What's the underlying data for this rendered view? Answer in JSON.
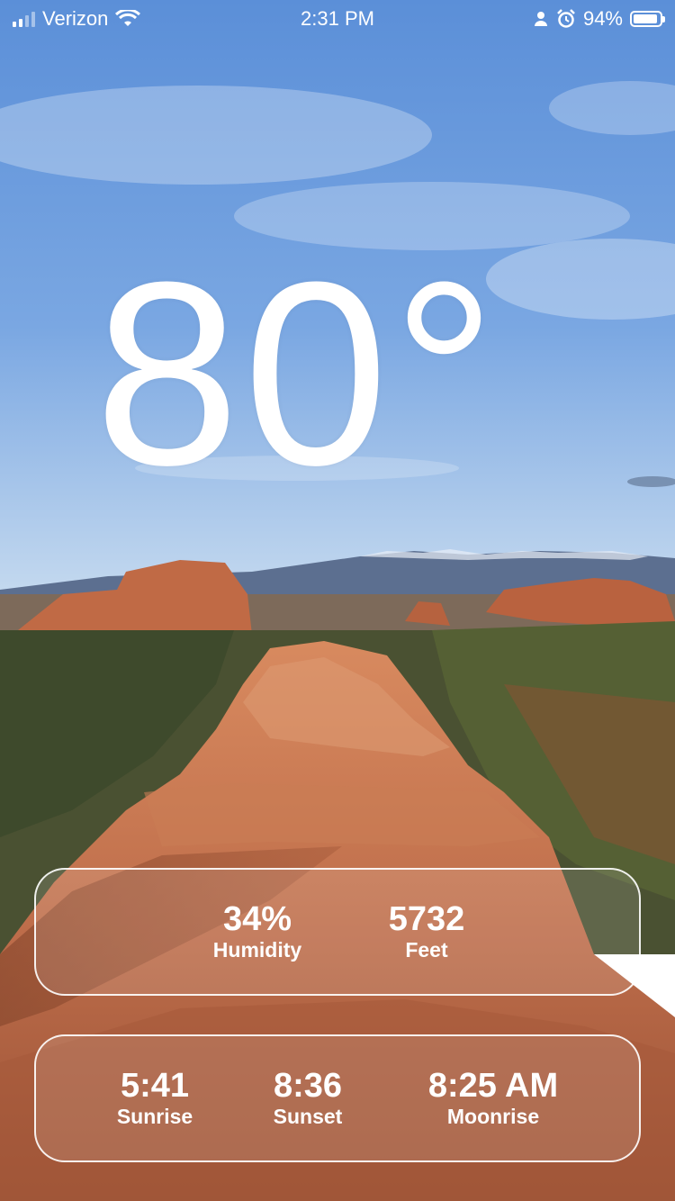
{
  "status_bar": {
    "carrier": "Verizon",
    "time": "2:31 PM",
    "battery": "94%",
    "battery_level": 0.94,
    "icons": [
      "signal-icon",
      "wifi-icon",
      "person-icon",
      "alarm-icon",
      "battery-icon"
    ]
  },
  "weather": {
    "temperature": "80°"
  },
  "card1": {
    "humidity_value": "34%",
    "humidity_label": "Humidity",
    "elevation_value": "5732",
    "elevation_label": "Feet"
  },
  "card2": {
    "sunrise_value": "5:41",
    "sunrise_label": "Sunrise",
    "sunset_value": "8:36",
    "sunset_label": "Sunset",
    "moonrise_value": "8:25 AM",
    "moonrise_label": "Moonrise"
  },
  "colors": {
    "sky_top": "#4f86d6",
    "sky_bottom": "#b9d3ee",
    "rock": "#c2734e",
    "vegetation": "#3d4a2a"
  }
}
